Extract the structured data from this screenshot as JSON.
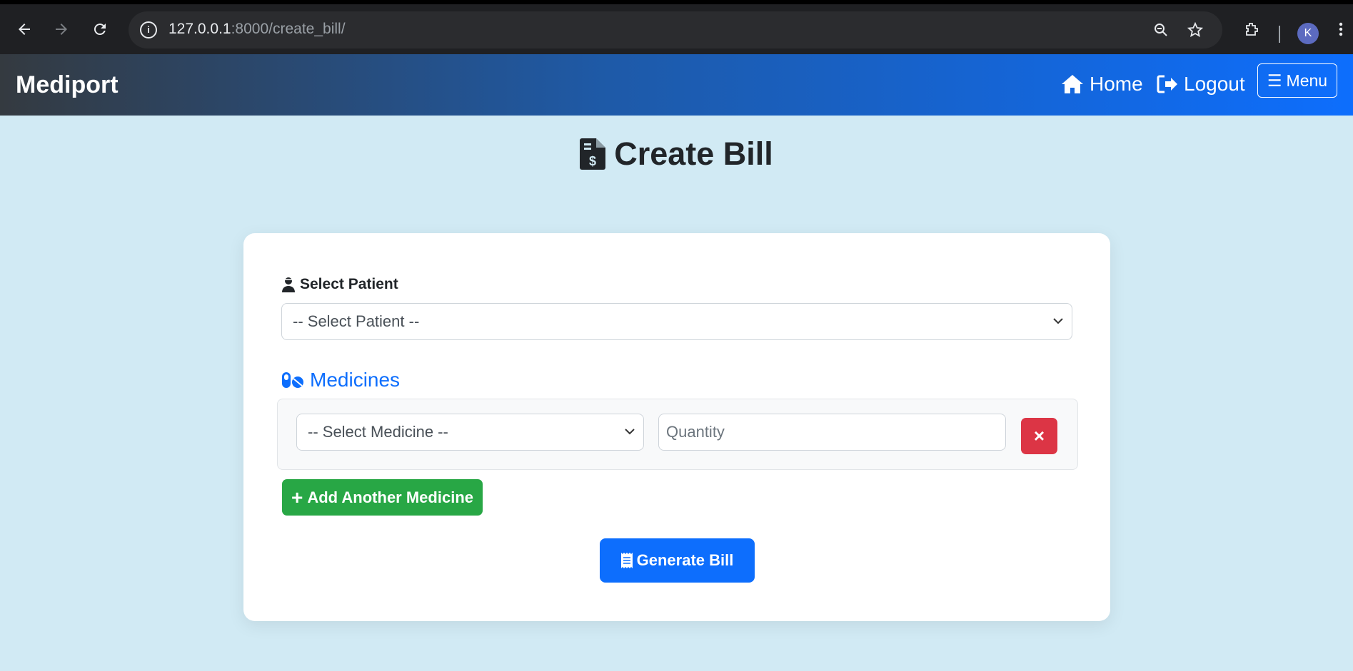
{
  "browser": {
    "url_host": "127.0.0.1",
    "url_path": ":8000/create_bill/",
    "avatar_letter": "K",
    "icons": [
      "back-arrow-icon",
      "forward-arrow-icon",
      "reload-icon",
      "site-info-icon",
      "zoom-icon",
      "bookmark-star-icon",
      "extensions-icon",
      "more-vert-icon"
    ]
  },
  "navbar": {
    "brand": "Mediport",
    "home_label": "Home",
    "logout_label": "Logout",
    "menu_label": "Menu"
  },
  "page": {
    "title": "Create Bill"
  },
  "form": {
    "patient_label": "Select Patient",
    "patient_selected": "-- Select Patient --",
    "medicines_title": "Medicines",
    "medicine_selected": "-- Select Medicine --",
    "quantity_placeholder": "Quantity",
    "delete_label": "×",
    "add_label": "Add Another Medicine",
    "generate_label": "Generate Bill"
  },
  "colors": {
    "primary": "#0d6efd",
    "success": "#28a745",
    "danger": "#dc3545",
    "page_bg": "#d1eaf4"
  }
}
